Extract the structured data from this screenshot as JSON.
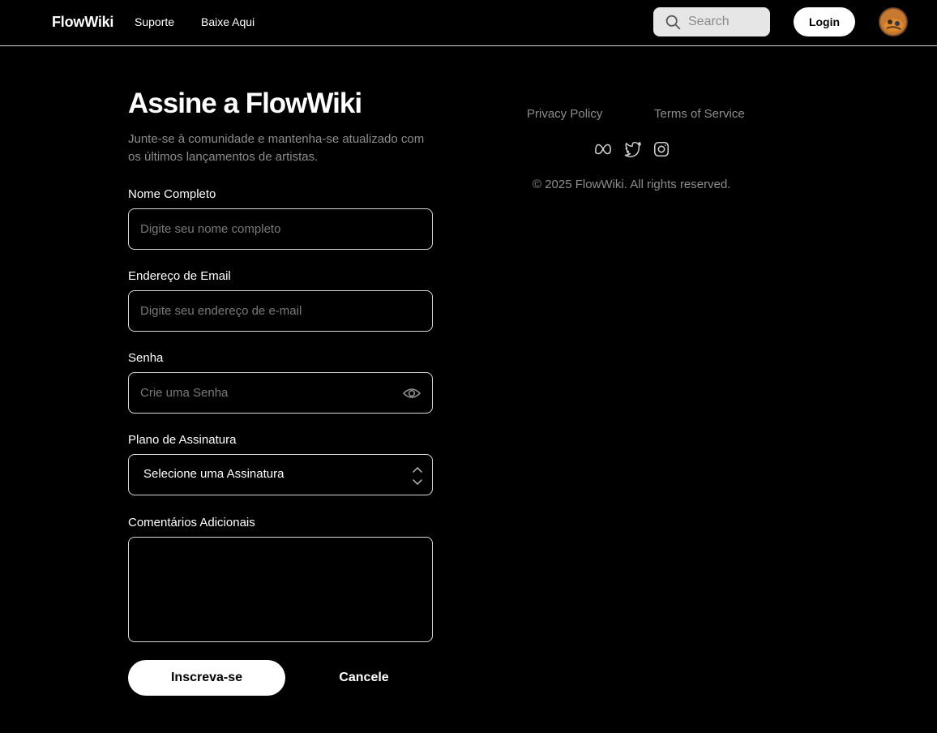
{
  "header": {
    "brand": "FlowWiki",
    "nav": [
      {
        "label": "Suporte"
      },
      {
        "label": "Baixe Aqui"
      }
    ],
    "search": {
      "placeholder": "Search",
      "icon": "search-icon"
    },
    "login_label": "Login",
    "avatar_icon": "avatar"
  },
  "form": {
    "title": "Assine a FlowWiki",
    "subtitle": "Junte-se à comunidade e mantenha-se atualizado com os últimos lançamentos de artistas.",
    "name": {
      "label": "Nome Completo",
      "placeholder": "Digite seu nome completo",
      "value": ""
    },
    "email": {
      "label": "Endereço de Email",
      "placeholder": "Digite seu endereço de e-mail",
      "value": ""
    },
    "password": {
      "label": "Senha",
      "placeholder": "Crie uma Senha",
      "value": "",
      "icon": "eye-icon"
    },
    "plan": {
      "label": "Plano de Assinatura",
      "selected": "Selecione uma Assinatura",
      "icon": "chevron-updown-icon"
    },
    "comments": {
      "label": "Comentários Adicionais",
      "value": ""
    },
    "submit_label": "Inscreva-se",
    "cancel_label": "Cancele"
  },
  "footer": {
    "links": [
      {
        "label": "Privacy Policy"
      },
      {
        "label": "Terms of Service"
      }
    ],
    "social_icons": [
      "meta-icon",
      "twitter-icon",
      "instagram-icon"
    ],
    "copyright": "© 2025 FlowWiki. All rights reserved."
  },
  "colors": {
    "background": "#000000",
    "text": "#ffffff",
    "muted": "#8d8d8d",
    "border": "#d9d9d9",
    "search_bg": "#e6e6e6"
  }
}
